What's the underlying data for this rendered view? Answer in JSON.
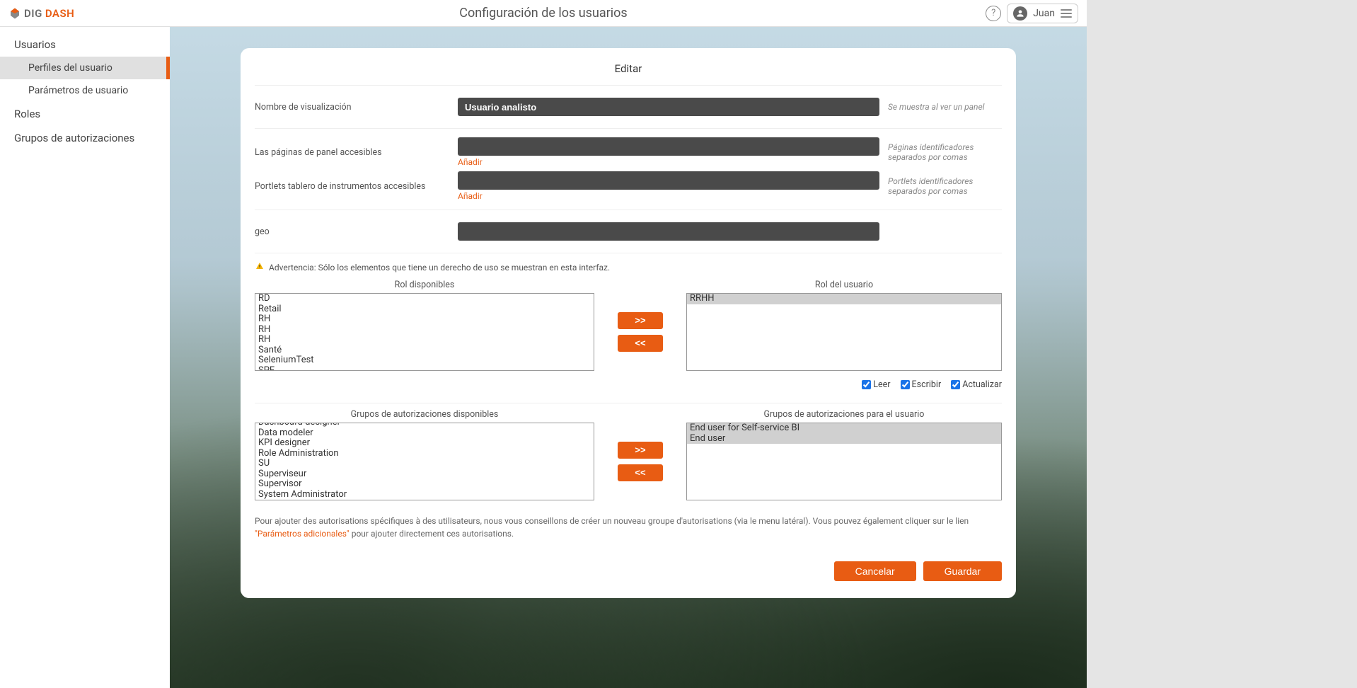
{
  "header": {
    "brand_dig": "DIG",
    "brand_dash": "DASH",
    "title": "Configuración de los usuarios",
    "user": "Juan"
  },
  "sidebar": {
    "items": [
      {
        "label": "Usuarios",
        "type": "item"
      },
      {
        "label": "Perfiles del usuario",
        "type": "subitem",
        "active": true
      },
      {
        "label": "Parámetros de usuario",
        "type": "subitem"
      },
      {
        "label": "Roles",
        "type": "item"
      },
      {
        "label": "Grupos de autorizaciones",
        "type": "item"
      }
    ]
  },
  "panel": {
    "title": "Editar",
    "display_name_label": "Nombre de visualización",
    "display_name_value": "Usuario analisto",
    "display_name_hint": "Se muestra al ver un panel",
    "pages_label": "Las páginas de panel accesibles",
    "pages_hint": "Páginas identificadores separados por comas",
    "portlets_label": "Portlets tablero de instrumentos accesibles",
    "portlets_hint": "Portlets identificadores separados por comas",
    "add_link": "Añadir",
    "geo_label": "geo",
    "warning_text": "Advertencia: Sólo los elementos que tiene un derecho de uso se muestran en esta interfaz.",
    "roles_available_header": "Rol disponibles",
    "roles_user_header": "Rol del usuario",
    "roles_available": [
      "RD",
      "Retail",
      "RH",
      "RH",
      "RH",
      "Santé",
      "SeleniumTest",
      "SPF"
    ],
    "roles_user": [
      "RRHH"
    ],
    "checkbox_read": "Leer",
    "checkbox_write": "Escribir",
    "checkbox_update": "Actualizar",
    "groups_available_header": "Grupos de autorizaciones disponibles",
    "groups_user_header": "Grupos de autorizaciones para el usuario",
    "groups_available": [
      "Dashboard designer",
      "Data modeler",
      "KPI designer",
      "Role Administration",
      "SU",
      "Superviseur",
      "Supervisor",
      "System Administrator"
    ],
    "groups_user": [
      "End user for Self-service BI",
      "End user"
    ],
    "info_text_before": "Pour ajouter des autorisations spécifiques à des utilisateurs, nous vous conseillons de créer un nouveau groupe d'autorisations (via le menu latéral). Vous pouvez également cliquer sur le lien ",
    "info_link": "\"Parámetros adicionales\"",
    "info_text_after": " pour ajouter directement ces autorisations.",
    "cancel_button": "Cancelar",
    "save_button": "Guardar",
    "arrow_right": ">>",
    "arrow_left": "<<"
  }
}
